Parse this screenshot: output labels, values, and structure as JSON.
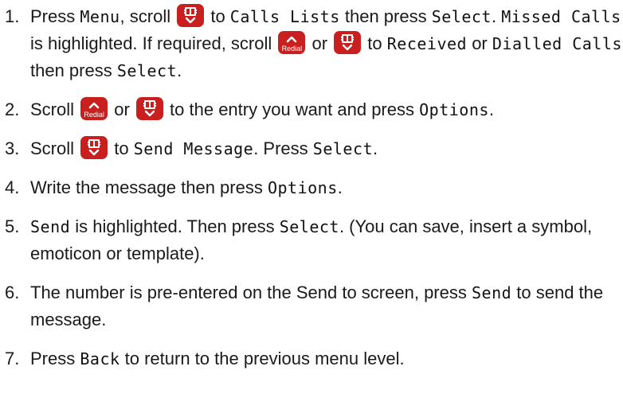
{
  "steps": [
    {
      "num": "1.",
      "parts": [
        {
          "t": "text",
          "v": "Press "
        },
        {
          "t": "lcd",
          "v": "Menu"
        },
        {
          "t": "text",
          "v": ", scroll "
        },
        {
          "t": "icon",
          "v": "phonebook-down-icon"
        },
        {
          "t": "text",
          "v": " to "
        },
        {
          "t": "lcd",
          "v": "Calls Lists"
        },
        {
          "t": "text",
          "v": " then press "
        },
        {
          "t": "lcd",
          "v": "Select"
        },
        {
          "t": "text",
          "v": ". "
        },
        {
          "t": "lcd",
          "v": "Missed Calls"
        },
        {
          "t": "text",
          "v": " is highlighted. If required, scroll "
        },
        {
          "t": "icon",
          "v": "redial-up-icon"
        },
        {
          "t": "text",
          "v": " or "
        },
        {
          "t": "icon",
          "v": "phonebook-down-icon"
        },
        {
          "t": "text",
          "v": " to "
        },
        {
          "t": "lcd",
          "v": "Received"
        },
        {
          "t": "text",
          "v": " or "
        },
        {
          "t": "lcd",
          "v": "Dialled Calls"
        },
        {
          "t": "text",
          "v": " then press "
        },
        {
          "t": "lcd",
          "v": "Select"
        },
        {
          "t": "text",
          "v": "."
        }
      ]
    },
    {
      "num": "2.",
      "parts": [
        {
          "t": "text",
          "v": "Scroll "
        },
        {
          "t": "icon",
          "v": "redial-up-icon"
        },
        {
          "t": "text",
          "v": " or "
        },
        {
          "t": "icon",
          "v": "phonebook-down-icon"
        },
        {
          "t": "text",
          "v": "  to the entry you want and press "
        },
        {
          "t": "lcd",
          "v": "Options"
        },
        {
          "t": "text",
          "v": "."
        }
      ]
    },
    {
      "num": "3.",
      "parts": [
        {
          "t": "text",
          "v": "Scroll "
        },
        {
          "t": "icon",
          "v": "phonebook-down-icon"
        },
        {
          "t": "text",
          "v": " to "
        },
        {
          "t": "lcd",
          "v": "Send Message"
        },
        {
          "t": "text",
          "v": ". Press "
        },
        {
          "t": "lcd",
          "v": "Select"
        },
        {
          "t": "text",
          "v": "."
        }
      ]
    },
    {
      "num": "4.",
      "parts": [
        {
          "t": "text",
          "v": "Write the message then press "
        },
        {
          "t": "lcd",
          "v": "Options"
        },
        {
          "t": "text",
          "v": "."
        }
      ]
    },
    {
      "num": "5.",
      "parts": [
        {
          "t": "lcd",
          "v": "Send"
        },
        {
          "t": "text",
          "v": " is highlighted. Then press "
        },
        {
          "t": "lcd",
          "v": "Select"
        },
        {
          "t": "text",
          "v": ". (You can save, insert a symbol, emoticon or template)."
        }
      ]
    },
    {
      "num": "6.",
      "parts": [
        {
          "t": "text",
          "v": "The number is pre-entered on the Send to screen, press "
        },
        {
          "t": "lcd",
          "v": "Send"
        },
        {
          "t": "text",
          "v": " to send the message."
        }
      ]
    },
    {
      "num": "7.",
      "parts": [
        {
          "t": "text",
          "v": "Press "
        },
        {
          "t": "lcd",
          "v": "Back"
        },
        {
          "t": "text",
          "v": " to return to the previous menu level."
        }
      ]
    }
  ],
  "icon_labels": {
    "redial": "Redial"
  },
  "colors": {
    "icon_background": "#ca1f1f",
    "icon_foreground": "#ffffff",
    "text": "#1a1a1a"
  }
}
